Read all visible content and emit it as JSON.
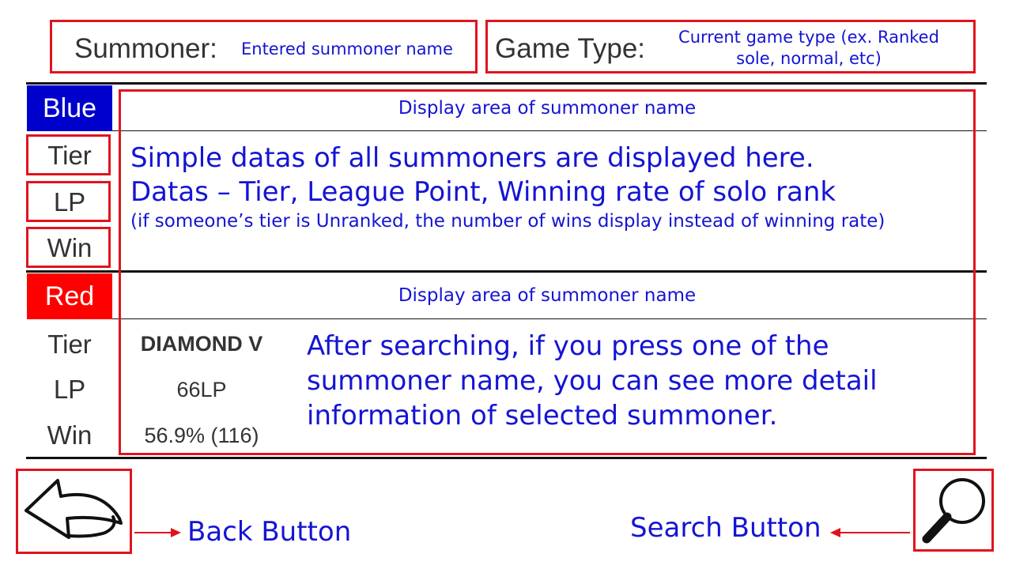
{
  "header": {
    "summoner_label": "Summoner:",
    "summoner_annotation": "Entered summoner name",
    "game_type_label": "Game Type:",
    "game_type_annotation_line1": "Current game type (ex. Ranked",
    "game_type_annotation_line2": "sole, normal, etc)"
  },
  "blue_team": {
    "label": "Blue",
    "name_area_annotation": "Display area of summoner name",
    "stat_labels": [
      "Tier",
      "LP",
      "Win"
    ],
    "description_line1": "Simple datas of all summoners are displayed here.",
    "description_line2": "Datas – Tier, League Point, Winning rate of solo rank",
    "description_line3": "(if someone’s tier is Unranked, the number of wins display instead of winning rate)"
  },
  "red_team": {
    "label": "Red",
    "name_area_annotation": "Display area of summoner name",
    "stat_labels": [
      "Tier",
      "LP",
      "Win"
    ],
    "sample": {
      "tier": "DIAMOND V",
      "lp": "66LP",
      "win": "56.9% (116)"
    },
    "description_line1": "After searching, if you press one of the",
    "description_line2": "summoner name, you can see more detail",
    "description_line3": "information of selected summoner."
  },
  "footer": {
    "back_annotation": "Back Button",
    "search_annotation": "Search Button",
    "back_icon": "back-arrow-icon",
    "search_icon": "magnifier-icon"
  },
  "colors": {
    "annotation_red": "#e0141e",
    "annotation_blue": "#1414d4",
    "blue_team": "#0000cc",
    "red_team": "#ff0000"
  }
}
